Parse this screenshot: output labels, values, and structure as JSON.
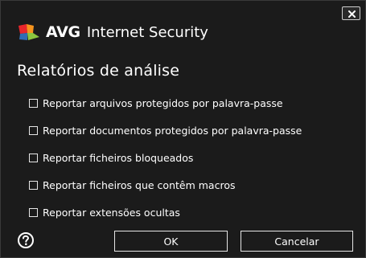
{
  "window": {
    "brand": "AVG",
    "product": "Internet Security",
    "close_icon": "close-icon"
  },
  "dialog": {
    "title": "Relatórios de análise",
    "options": [
      {
        "label": "Reportar arquivos protegidos por palavra-passe",
        "checked": false
      },
      {
        "label": "Reportar documentos protegidos por palavra-passe",
        "checked": false
      },
      {
        "label": "Reportar ficheiros bloqueados",
        "checked": false
      },
      {
        "label": "Reportar ficheiros que contêm macros",
        "checked": false
      },
      {
        "label": "Reportar extensões ocultas",
        "checked": false
      }
    ]
  },
  "footer": {
    "help_icon": "question-circle-icon",
    "ok_label": "OK",
    "cancel_label": "Cancelar"
  },
  "colors": {
    "background": "#1b1b1b",
    "text": "#ffffff",
    "logo_red": "#e8262b",
    "logo_orange": "#f7941d",
    "logo_green": "#8cc63f",
    "logo_blue": "#2e6db4"
  }
}
